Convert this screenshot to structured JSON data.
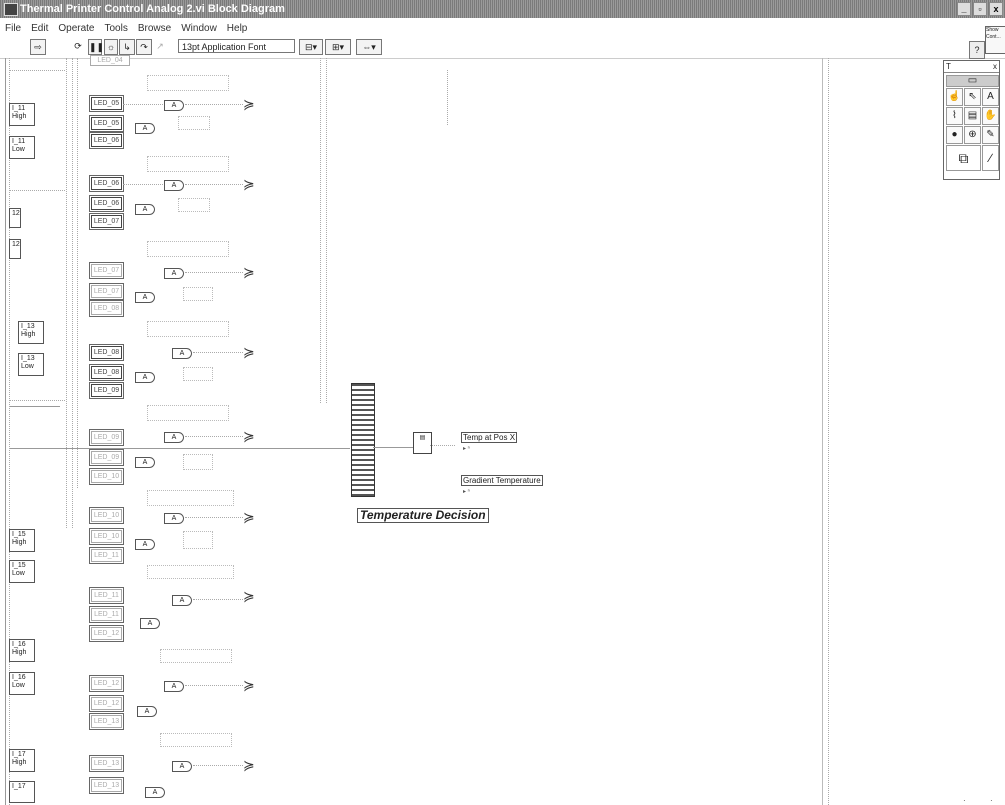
{
  "window": {
    "title": "Thermal Printer Control Analog 2.vi Block Diagram",
    "buttons": [
      "_",
      "▫",
      "x"
    ]
  },
  "menu": [
    "File",
    "Edit",
    "Operate",
    "Tools",
    "Browse",
    "Window",
    "Help"
  ],
  "toolbar": {
    "font": "13pt Application Font",
    "help": "?",
    "context_help_text": "Show Cont..."
  },
  "left_terminals": [
    {
      "id": "t11h",
      "text": "I_11\nHigh"
    },
    {
      "id": "t11l",
      "text": "I_11\nLow"
    },
    {
      "id": "t12a",
      "text": "12\n"
    },
    {
      "id": "t12b",
      "text": "12\n"
    },
    {
      "id": "t13h",
      "text": "I_13\nHigh"
    },
    {
      "id": "t13l",
      "text": "I_13\nLow"
    },
    {
      "id": "t15h",
      "text": "I_15\nHigh"
    },
    {
      "id": "t15l",
      "text": "I_15\nLow"
    },
    {
      "id": "t16h",
      "text": "I_16\nHigh"
    },
    {
      "id": "t16l",
      "text": "I_16\nLow"
    },
    {
      "id": "t17h",
      "text": "I_17\nHigh"
    },
    {
      "id": "t17l",
      "text": "I_17\n"
    }
  ],
  "leds": {
    "b1": [
      "LED_05",
      "LED_05",
      "LED_06"
    ],
    "b2": [
      "LED_06",
      "LED_06",
      "LED_07"
    ],
    "b3": [
      "LED_07",
      "LED_07",
      "LED_08"
    ],
    "b4": [
      "LED_08",
      "LED_08",
      "LED_09"
    ],
    "b5": [
      "LED_09",
      "LED_09",
      "LED_10"
    ],
    "b6": [
      "LED_10",
      "LED_10",
      "LED_11"
    ],
    "b7": [
      "LED_11",
      "LED_11",
      "LED_12"
    ],
    "b8": [
      "LED_12",
      "LED_12",
      "LED_13"
    ],
    "b9": [
      "LED_13",
      "LED_13"
    ],
    "top": "LED_04"
  },
  "gate_and": "A",
  "gate_or": "≽",
  "indicators": {
    "temp_pos": "Temp at Pos X",
    "gradient": "Gradient Temperature"
  },
  "caption": "Temperature Decision",
  "tools_palette": {
    "title": "T",
    "close": "x"
  },
  "colors": {
    "titlebar": "#8a8a8a",
    "background": "#ffffff"
  }
}
